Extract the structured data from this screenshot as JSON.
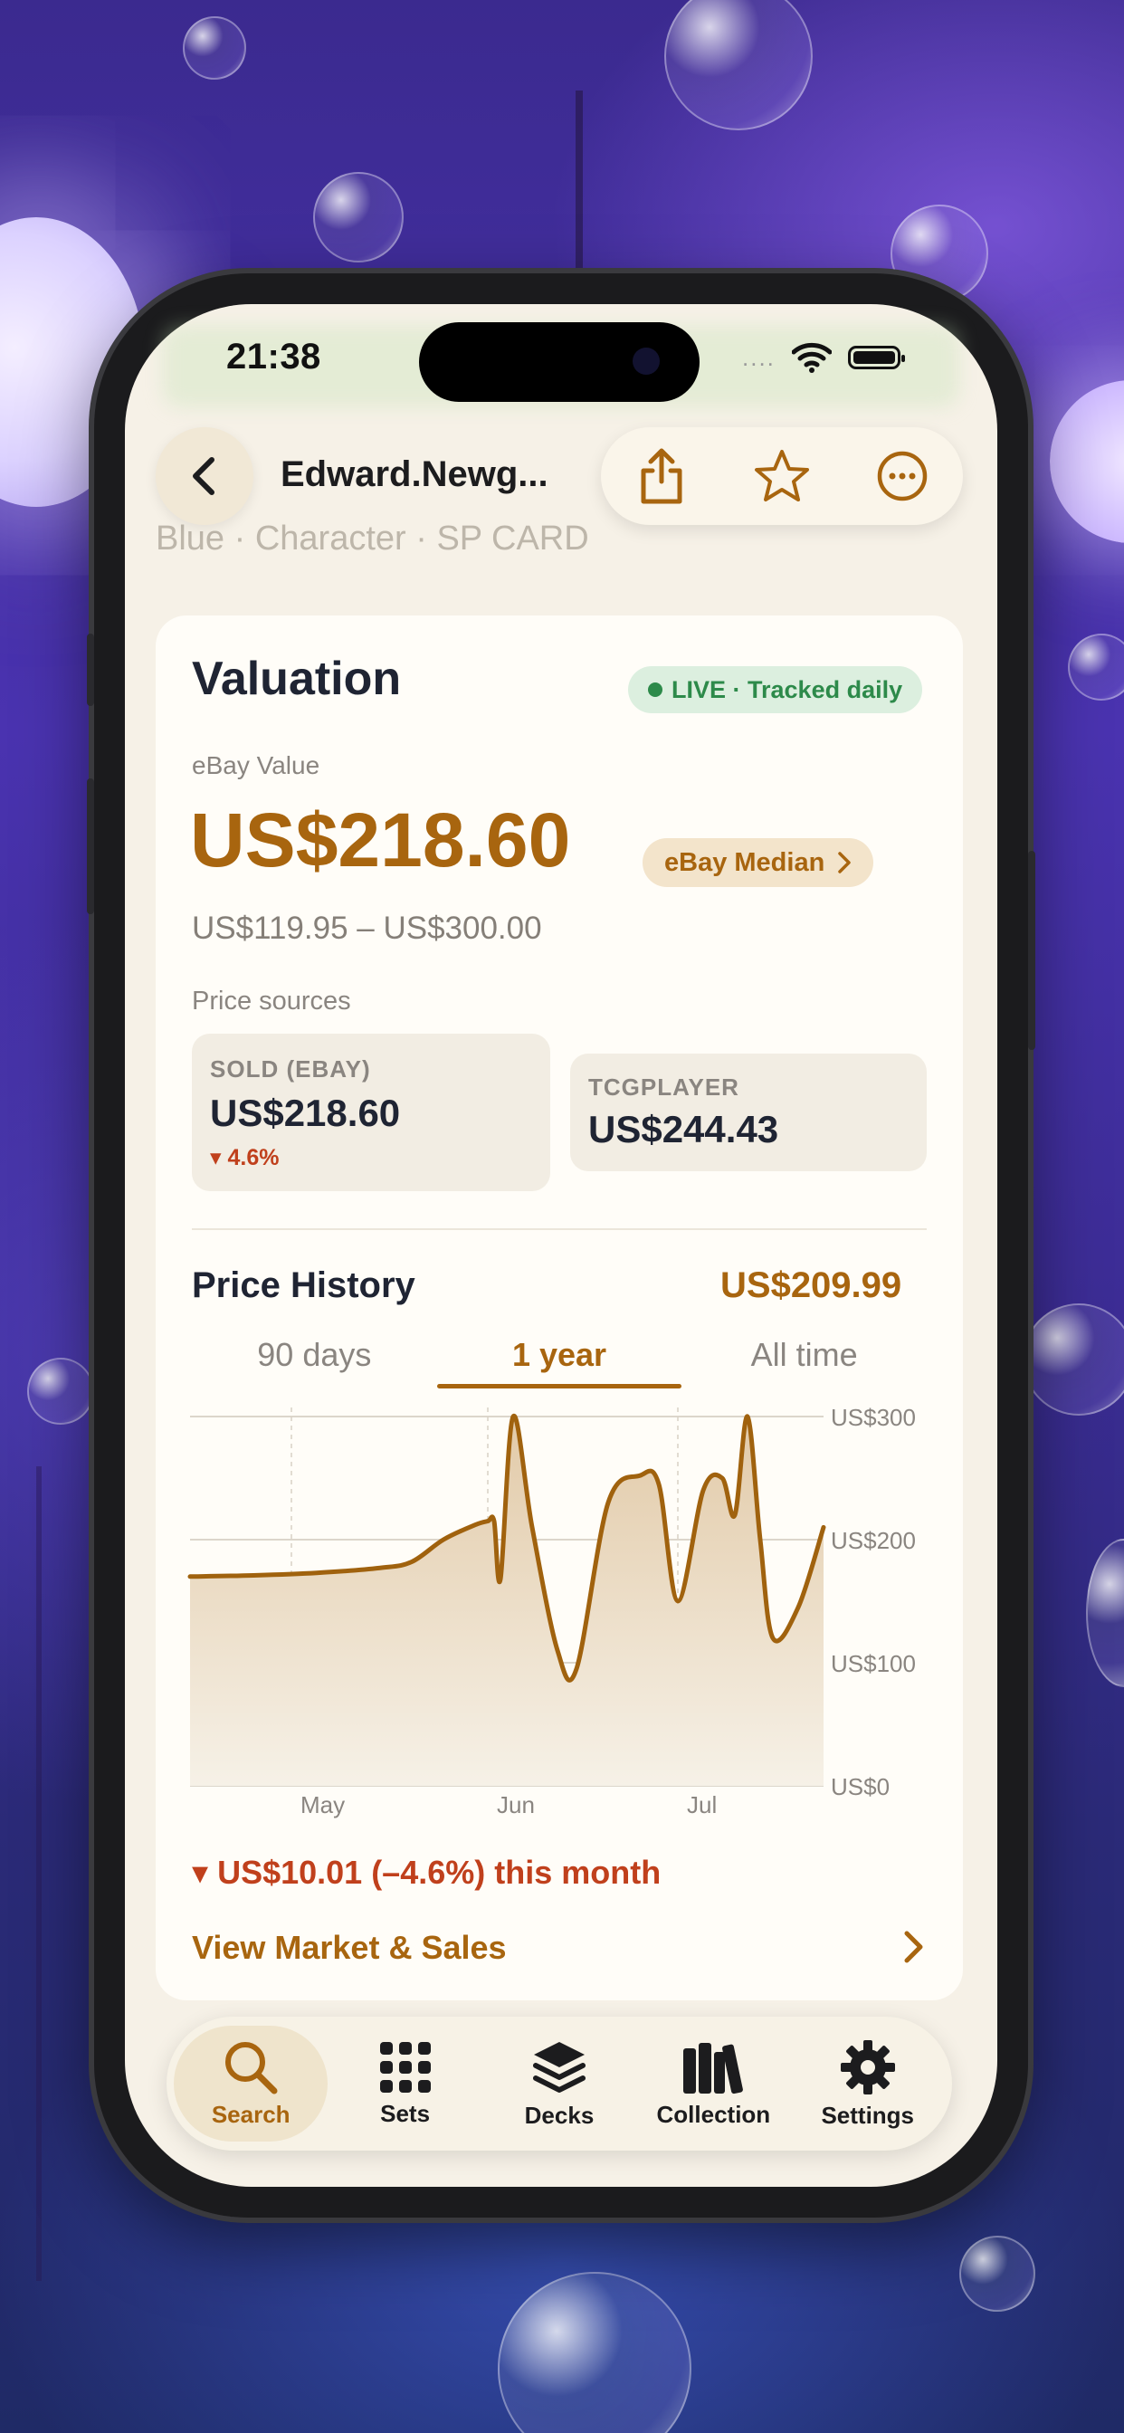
{
  "status_bar": {
    "time": "21:38",
    "dots": "....",
    "wifi_icon": "wifi-icon",
    "battery_icon": "battery-icon"
  },
  "header": {
    "title": "Edward.Newg...",
    "subtitle": "Blue · Character · SP CARD",
    "back_icon": "chevron-left-icon",
    "actions": [
      "share-icon",
      "star-icon",
      "more-icon"
    ]
  },
  "valuation": {
    "title": "Valuation",
    "live_badge": "LIVE · Tracked daily",
    "value_label": "eBay Value",
    "price": "US$218.60",
    "median_chip": "eBay Median",
    "range": "US$119.95 – US$300.00",
    "sources_label": "Price sources",
    "sources": [
      {
        "label": "SOLD (EBAY)",
        "price": "US$218.60",
        "change": "▾ 4.6%"
      },
      {
        "label": "TCGPLAYER",
        "price": "US$244.43"
      }
    ]
  },
  "price_history": {
    "title": "Price History",
    "current_price": "US$209.99",
    "tabs": [
      "90 days",
      "1 year",
      "All time"
    ],
    "active_tab": "1 year",
    "change_text": "▾ US$10.01 (–4.6%) this month",
    "market_link": "View Market & Sales"
  },
  "chart_data": {
    "type": "area",
    "x_tick_labels": [
      "May",
      "Jun",
      "Jul"
    ],
    "y_tick_labels": [
      "US$300",
      "US$200",
      "US$100",
      "US$0"
    ],
    "ylim": [
      0,
      300
    ],
    "grid": true,
    "x": [
      "Apr 15",
      "Apr 25",
      "May 5",
      "May 15",
      "May 20",
      "May 25",
      "May 30",
      "Jun 1",
      "Jun 2",
      "Jun 3",
      "Jun 5",
      "Jun 8",
      "Jun 12",
      "Jun 15",
      "Jun 20",
      "Jun 25",
      "Jun 28",
      "Jul 1",
      "Jul 5",
      "Jul 8",
      "Jul 10",
      "Jul 12",
      "Jul 14",
      "Jul 16",
      "Jul 20",
      "Jul 24"
    ],
    "series": [
      {
        "values": [
          170,
          171,
          173,
          177,
          182,
          200,
          212,
          215,
          215,
          168,
          300,
          210,
          110,
          95,
          230,
          252,
          245,
          150,
          240,
          250,
          220,
          300,
          200,
          120,
          145,
          210
        ]
      }
    ],
    "colors": {
      "line": "#a0620e",
      "fill_top": "#e2caa8",
      "fill_bottom": "#f6f1e7"
    }
  },
  "tab_bar": {
    "items": [
      {
        "label": "Search",
        "icon": "search-icon"
      },
      {
        "label": "Sets",
        "icon": "grid-icon"
      },
      {
        "label": "Decks",
        "icon": "layers-icon"
      },
      {
        "label": "Collection",
        "icon": "books-icon"
      },
      {
        "label": "Settings",
        "icon": "gear-icon"
      }
    ],
    "active": "Search"
  },
  "colors": {
    "accent": "#a8650f",
    "negative": "#c0401c",
    "live": "#2d8a4a",
    "text": "#1f2433"
  }
}
